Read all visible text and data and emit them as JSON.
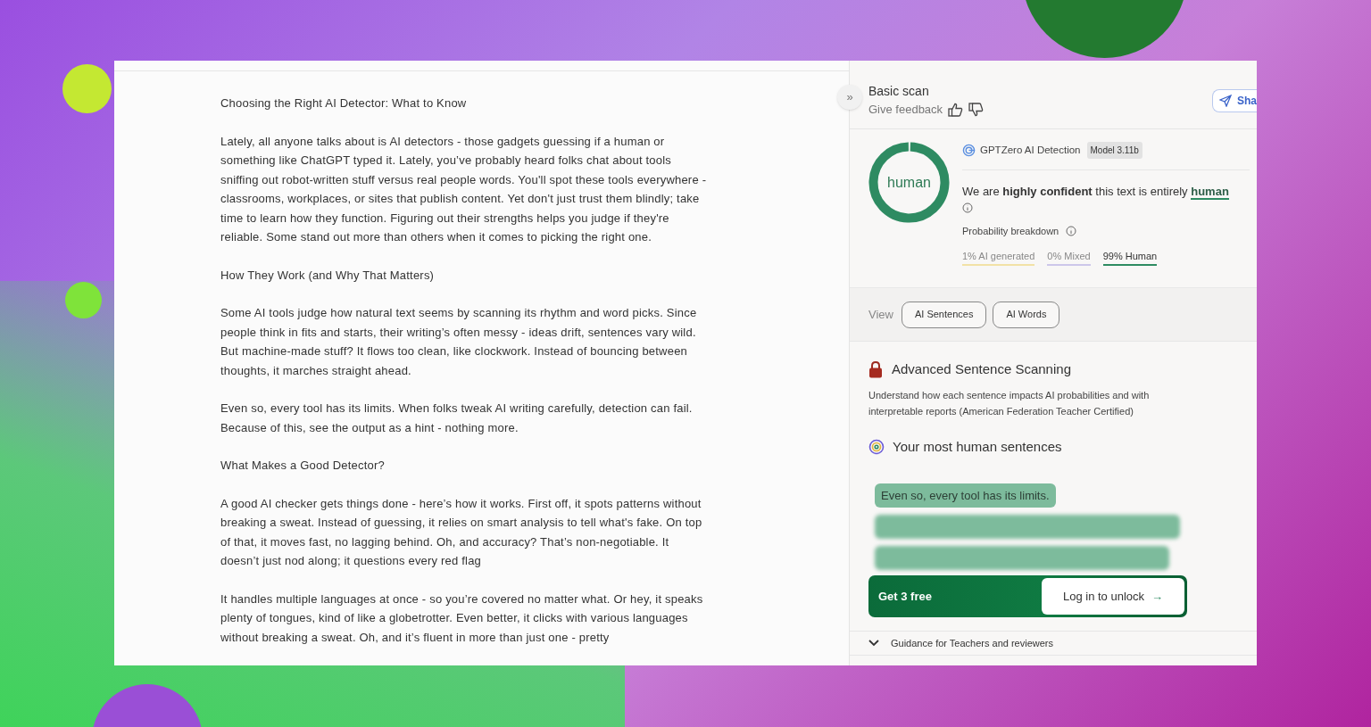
{
  "document": {
    "paragraphs": [
      "Choosing the Right AI Detector: What to Know",
      "Lately, all anyone talks about is AI detectors - those gadgets guessing if a human or something like ChatGPT typed it. Lately, you’ve probably heard folks chat about tools sniffing out robot-written stuff versus real people words. You'll spot these tools everywhere - classrooms, workplaces, or sites that publish content. Yet don't just trust them blindly; take time to learn how they function. Figuring out their strengths helps you judge if they're reliable. Some stand out more than others when it comes to picking the right one.",
      "How They Work (and Why That Matters)",
      "Some AI tools judge how natural text seems by scanning its rhythm and word picks. Since people think in fits and starts, their writing’s often messy - ideas drift, sentences vary wild. But machine-made stuff? It flows too clean, like clockwork. Instead of bouncing between thoughts, it marches straight ahead.",
      "Even so, every tool has its limits. When folks tweak AI writing carefully, detection can fail. Because of this, see the output as a hint - nothing more.",
      "What Makes a Good Detector?",
      "A good AI checker gets things done - here’s how it works. First off, it spots patterns without breaking a sweat. Instead of guessing, it relies on smart analysis to tell what's fake. On top of that, it moves fast, no lagging behind. Oh, and accuracy? That’s non-negotiable. It doesn’t just nod along; it questions every red flag",
      "It handles multiple languages at once - so you’re covered no matter what. Or hey, it speaks plenty of tongues, kind of like a globetrotter. Even better, it clicks with various languages without breaking a sweat. Oh, and it’s fluent in more than just one - pretty"
    ]
  },
  "side_panel": {
    "collapse": "»",
    "title": "Basic scan",
    "feedback_label": "Give feedback",
    "share_label": "Sha",
    "result": {
      "verdict": "human",
      "level": 0.99,
      "detector": "GPTZero AI Detection",
      "model_badge": "Model 3.11b",
      "statement": "We are **highly confident** this text is entirely",
      "statement_highlight": "human",
      "breakdown_label": "Probability breakdown",
      "breakdown": [
        {
          "label": "1% AI generated",
          "color": "#f2e2a6",
          "selected": false
        },
        {
          "label": "0% Mixed",
          "color": "#cdc7ea",
          "selected": false
        },
        {
          "label": "99% Human",
          "color": "#2e8b62",
          "selected": true
        }
      ]
    },
    "view": {
      "label": "View",
      "options": [
        "AI Sentences",
        "AI Words"
      ]
    },
    "advanced": {
      "title": "Advanced Sentence Scanning",
      "description": "Understand how each sentence impacts AI probabilities and with interpretable reports (American Federation Teacher Certified)",
      "human_sentences_title": "Your most human sentences",
      "sentences": [
        {
          "blurred": false,
          "text": "Even so, every tool has its limits."
        },
        {
          "blurred": true
        },
        {
          "blurred": true
        }
      ]
    },
    "unlock": {
      "offer": "Get 3 free",
      "button": "Log in to unlock",
      "arrow": "→"
    },
    "guidance": {
      "label": "Guidance for Teachers and reviewers",
      "expanded": false
    }
  }
}
